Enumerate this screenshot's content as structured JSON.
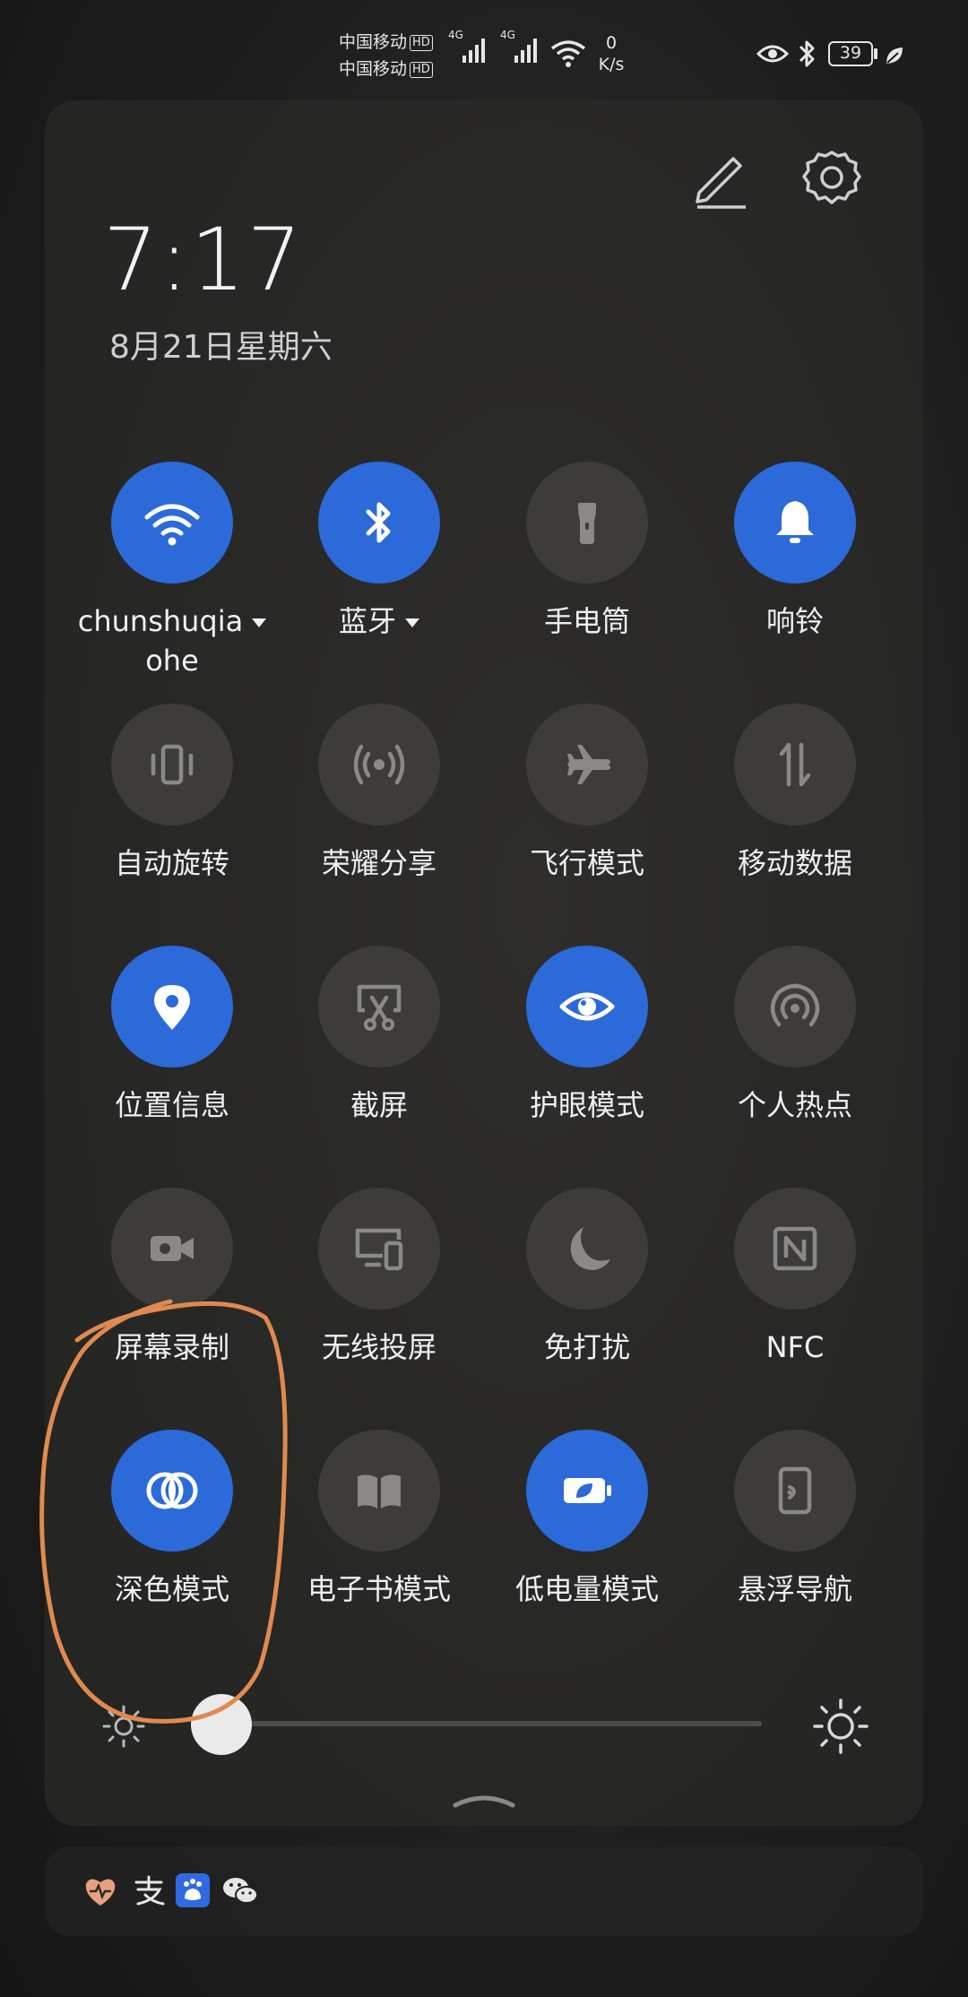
{
  "status_bar": {
    "carrier1": "中国移动",
    "carrier2": "中国移动",
    "hd": "HD",
    "network1": "4G",
    "network2": "4G",
    "speed_value": "0",
    "speed_unit": "K/s",
    "battery": "39",
    "icons": [
      "eye-icon",
      "bluetooth-icon",
      "battery-icon",
      "leaf-icon"
    ]
  },
  "header": {
    "time": "7:17",
    "date": "8月21日星期六",
    "edit_icon": "pencil-icon",
    "settings_icon": "gear-icon"
  },
  "tiles": [
    {
      "id": "wifi",
      "label": "chunshuqia",
      "label2": "ohe",
      "dropdown": true,
      "on": true,
      "icon": "wifi-icon"
    },
    {
      "id": "bluetooth",
      "label": "蓝牙",
      "dropdown": true,
      "on": true,
      "icon": "bluetooth-icon"
    },
    {
      "id": "flashlight",
      "label": "手电筒",
      "on": false,
      "icon": "flashlight-icon"
    },
    {
      "id": "ring",
      "label": "响铃",
      "on": true,
      "icon": "bell-icon"
    },
    {
      "id": "autorotate",
      "label": "自动旋转",
      "on": false,
      "icon": "rotate-icon"
    },
    {
      "id": "honor-share",
      "label": "荣耀分享",
      "on": false,
      "icon": "share-waves-icon"
    },
    {
      "id": "airplane",
      "label": "飞行模式",
      "on": false,
      "icon": "airplane-icon"
    },
    {
      "id": "mobile-data",
      "label": "移动数据",
      "on": false,
      "icon": "data-arrows-icon"
    },
    {
      "id": "location",
      "label": "位置信息",
      "on": true,
      "icon": "location-pin-icon"
    },
    {
      "id": "screenshot",
      "label": "截屏",
      "on": false,
      "icon": "scissors-icon"
    },
    {
      "id": "eye-comfort",
      "label": "护眼模式",
      "on": true,
      "icon": "eye-icon"
    },
    {
      "id": "hotspot",
      "label": "个人热点",
      "on": false,
      "icon": "hotspot-icon"
    },
    {
      "id": "screen-record",
      "label": "屏幕录制",
      "on": false,
      "icon": "video-camera-icon"
    },
    {
      "id": "wireless-projection",
      "label": "无线投屏",
      "on": false,
      "icon": "cast-screen-icon"
    },
    {
      "id": "dnd",
      "label": "免打扰",
      "on": false,
      "icon": "moon-icon"
    },
    {
      "id": "nfc",
      "label": "NFC",
      "on": false,
      "icon": "nfc-icon"
    },
    {
      "id": "dark-mode",
      "label": "深色模式",
      "on": true,
      "icon": "dark-mode-icon"
    },
    {
      "id": "ebook",
      "label": "电子书模式",
      "on": false,
      "icon": "book-icon"
    },
    {
      "id": "low-power",
      "label": "低电量模式",
      "on": true,
      "icon": "battery-saver-icon"
    },
    {
      "id": "floating-nav",
      "label": "悬浮导航",
      "on": false,
      "icon": "floating-dock-icon"
    }
  ],
  "brightness": {
    "level": 0.03
  },
  "notifications": {
    "icons": [
      "health-icon",
      "alipay-icon",
      "baidu-icon",
      "wechat-icon"
    ]
  },
  "colors": {
    "accent": "#2b6ad8",
    "tile_off": "#3d3c3b",
    "annotation": "#e08a50"
  }
}
